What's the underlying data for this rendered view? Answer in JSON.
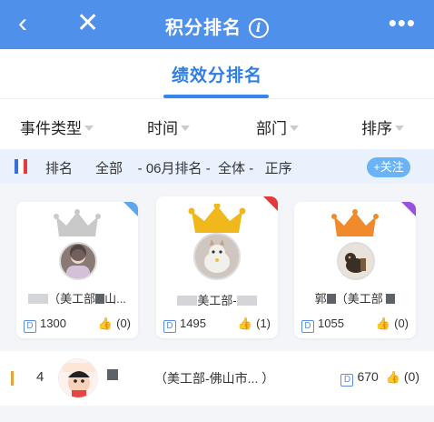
{
  "nav": {
    "back_icon": "‹",
    "close_icon": "✕",
    "title": "积分排名",
    "info_icon": "i",
    "more_icon": "•••",
    "bg_color": "#4f91ea"
  },
  "tabs": [
    {
      "label": "绩效分排名",
      "active": true
    }
  ],
  "filters": [
    {
      "label": "事件类型"
    },
    {
      "label": "时间"
    },
    {
      "label": "部门"
    },
    {
      "label": "排序"
    }
  ],
  "summary": {
    "text": "排名      全部    - 06月排名 -  全体 -   正序",
    "follow_label": "+关注"
  },
  "top3": [
    {
      "rank": 2,
      "crown_color": "#c9c9c9",
      "corner_color": "#5aa6f0",
      "name_prefix": "（美工部",
      "name_suffix": "山...",
      "points": "1300",
      "likes": "(0)"
    },
    {
      "rank": 1,
      "crown_color": "#f1b81c",
      "corner_color": "#e23a3a",
      "name_prefix": "美工部-",
      "name_suffix": "",
      "points": "1495",
      "likes": "(1)"
    },
    {
      "rank": 3,
      "crown_color": "#f08a2c",
      "corner_color": "#9a4fe0",
      "name_prefix": "郭",
      "name_suffix": "（美工部",
      "points": "1055",
      "likes": "(0)"
    }
  ],
  "list": [
    {
      "rank": "4",
      "dept": "（美工部-佛山市...   ）",
      "points": "670",
      "likes": "(0)"
    }
  ],
  "icons": {
    "points": "D",
    "like": "thumbs-up-icon"
  }
}
